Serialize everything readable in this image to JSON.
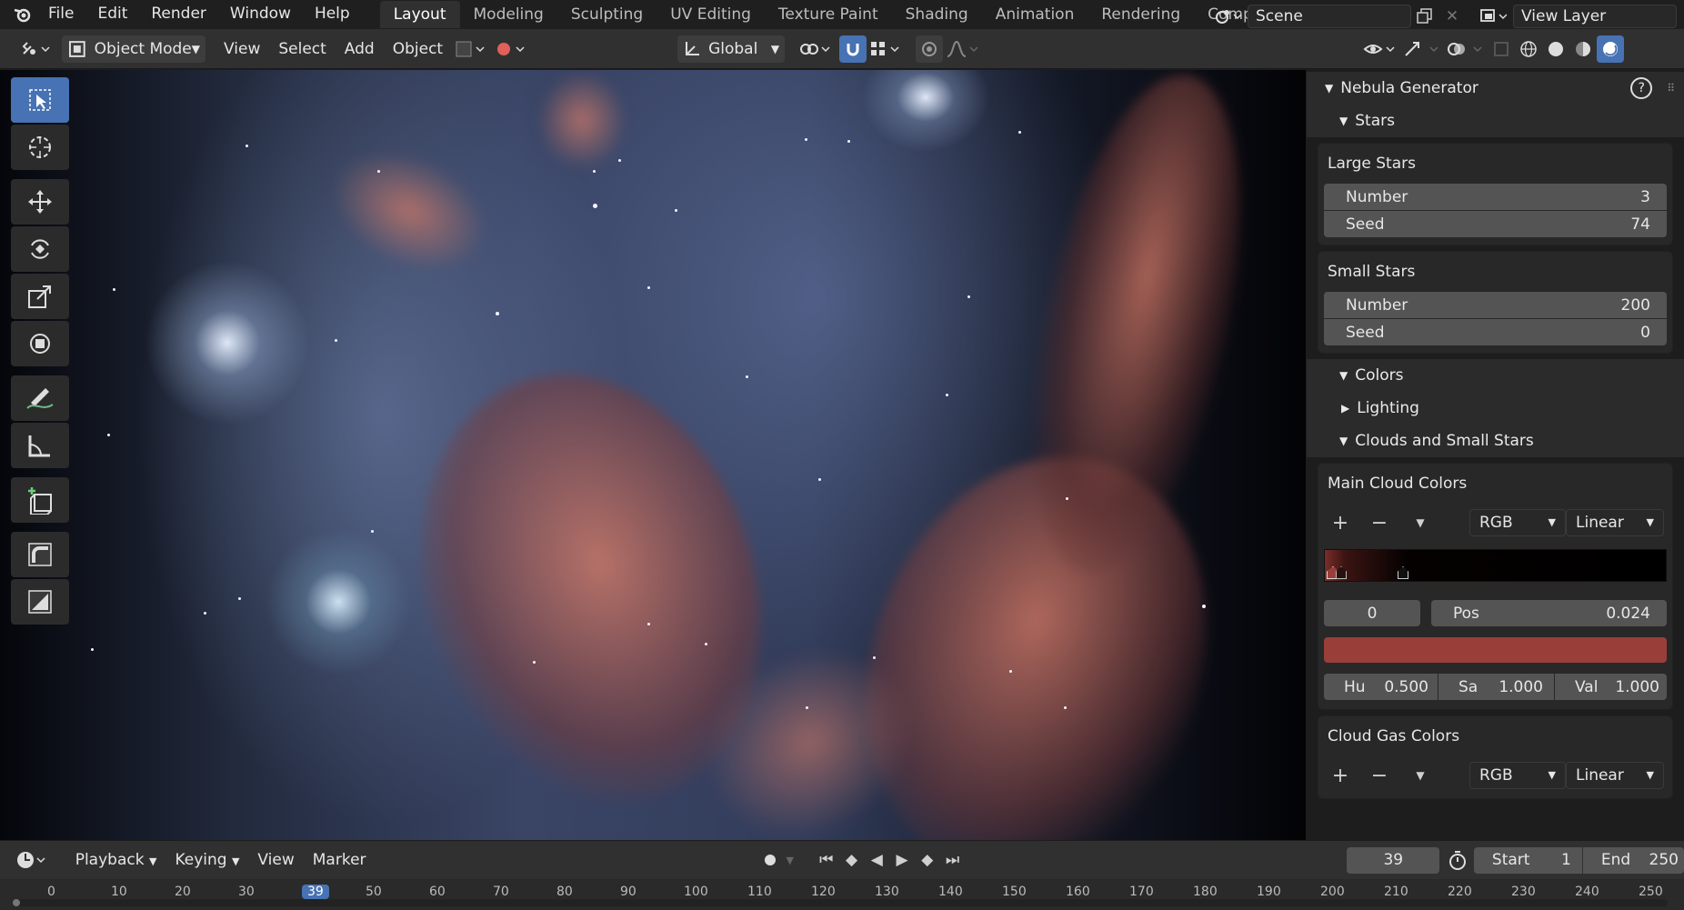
{
  "topbar": {
    "menus": [
      "File",
      "Edit",
      "Render",
      "Window",
      "Help"
    ],
    "workspaces": [
      "Layout",
      "Modeling",
      "Sculpting",
      "UV Editing",
      "Texture Paint",
      "Shading",
      "Animation",
      "Rendering",
      "Compo"
    ],
    "scene": "Scene",
    "view_layer": "View Layer"
  },
  "header": {
    "mode": "Object Mode",
    "menus": [
      "View",
      "Select",
      "Add",
      "Object"
    ],
    "orientation": "Global"
  },
  "panel": {
    "title": "Nebula Generator",
    "stars_label": "Stars",
    "large_stars": {
      "title": "Large Stars",
      "number_label": "Number",
      "number": "3",
      "seed_label": "Seed",
      "seed": "74"
    },
    "small_stars": {
      "title": "Small Stars",
      "number_label": "Number",
      "number": "200",
      "seed_label": "Seed",
      "seed": "0"
    },
    "colors_label": "Colors",
    "lighting_label": "Lighting",
    "clouds_label": "Clouds and Small Stars",
    "main_cloud": {
      "title": "Main Cloud Colors",
      "color_mode": "RGB",
      "interpolation": "Linear",
      "stop_index": "0",
      "pos_label": "Pos",
      "pos": "0.024",
      "swatch_color": "#9a3e3a",
      "hu_label": "Hu",
      "hu": "0.500",
      "sa_label": "Sa",
      "sa": "1.000",
      "val_label": "Val",
      "val": "1.000"
    },
    "cloud_gas": {
      "title": "Cloud Gas Colors",
      "color_mode": "RGB",
      "interpolation": "Linear"
    }
  },
  "timeline": {
    "menus": [
      "Playback",
      "Keying",
      "View",
      "Marker"
    ],
    "current_frame": "39",
    "start_label": "Start",
    "start": "1",
    "end_label": "End",
    "end": "250",
    "ticks": [
      "0",
      "10",
      "20",
      "30",
      "39",
      "50",
      "60",
      "70",
      "80",
      "90",
      "100",
      "110",
      "120",
      "130",
      "140",
      "150",
      "160",
      "170",
      "180",
      "190",
      "200",
      "210",
      "220",
      "230",
      "240",
      "250"
    ]
  },
  "colors": {
    "accent": "#4772b3",
    "nebula_cloud": "#b56a60"
  }
}
